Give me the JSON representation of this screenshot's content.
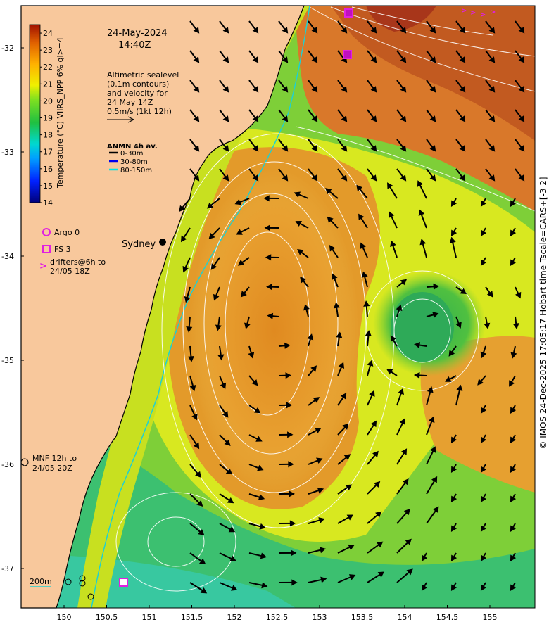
{
  "map": {
    "date": "24-May-2024",
    "time": "14:40Z",
    "colorbar": {
      "label": "Temperature (°C) VIIRS_NPP 6% ql>=4",
      "ticks": [
        "24",
        "23",
        "22",
        "21",
        "20",
        "19",
        "18",
        "17",
        "16",
        "15",
        "14"
      ],
      "min": 14,
      "max": 24.5
    },
    "altimetry_note": [
      "Altimetric sealevel",
      "(0.1m contours)",
      "and velocity for",
      "24 May 14Z",
      "0.5m/s (1kt 12h)"
    ],
    "anmn": {
      "title": "ANMN 4h av.",
      "items": [
        {
          "label": "0-30m",
          "color": "#000000"
        },
        {
          "label": "30-80m",
          "color": "#0000ee"
        },
        {
          "label": "80-150m",
          "color": "#00e5e5"
        }
      ]
    },
    "markers": {
      "argo": "Argo 0",
      "fs": "FS 3",
      "drifters": [
        "drifters@6h to",
        "24/05 18Z"
      ],
      "mnf": [
        "MNF 12h to",
        "24/05 20Z"
      ],
      "isobath": "200m"
    },
    "places": {
      "sydney": "Sydney"
    },
    "lat_ticks": [
      "-32",
      "-33",
      "-34",
      "-35",
      "-36",
      "-37"
    ],
    "lon_ticks": [
      "150",
      "150.5",
      "151",
      "151.5",
      "152",
      "152.5",
      "153",
      "153.5",
      "154",
      "154.5",
      "155"
    ],
    "credit": "© IMOS 24-Dec-2025 17:05:17 Hobart time Tscale=CARS+[-3 2]",
    "colors": {
      "land": "#f8c89c",
      "warm": "#e0a030",
      "cool": "#55c040",
      "contour": "#ffffff",
      "argo_fs_drifter": "#e020e0",
      "isobath": "#20d0d0"
    }
  }
}
